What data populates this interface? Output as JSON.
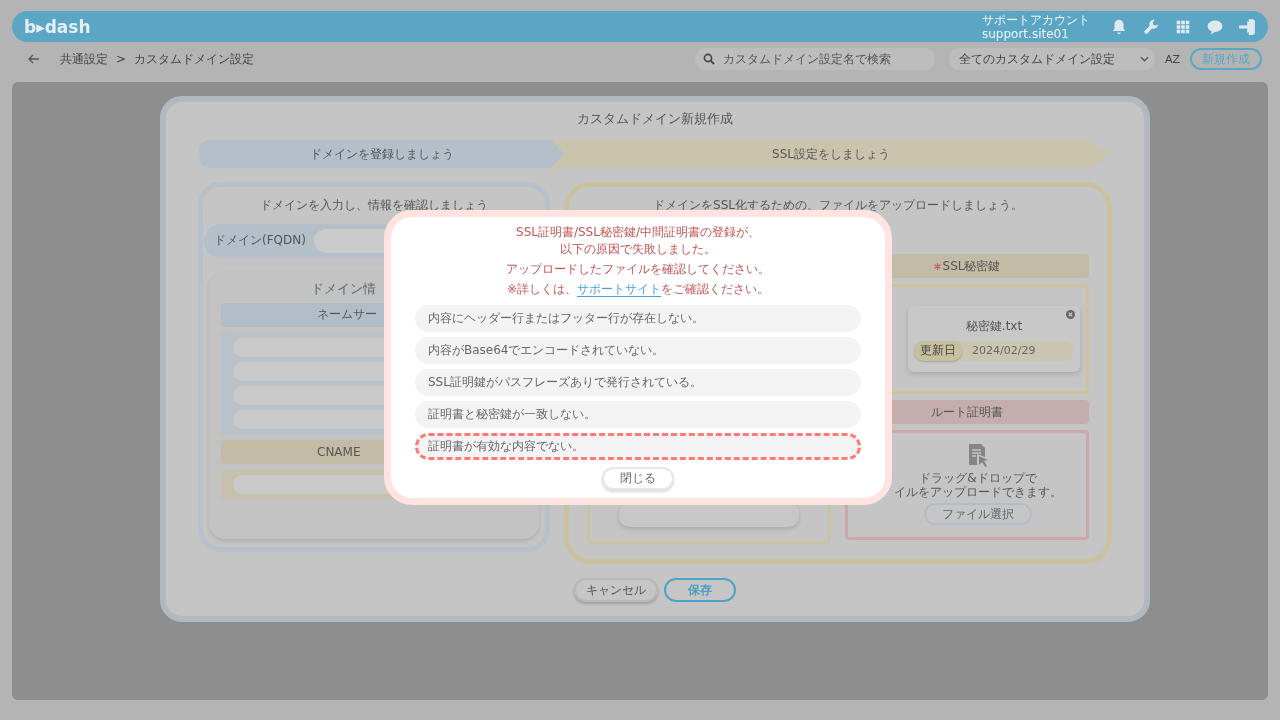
{
  "header": {
    "logo": "b▸dash",
    "account_name": "サポートアカウント",
    "account_id": "support.site01"
  },
  "toolbar": {
    "breadcrumb": [
      "共通設定",
      "カスタムドメイン設定"
    ],
    "breadcrumb_separator": ">",
    "search": {
      "placeholder": "カスタムドメイン設定名で検索"
    },
    "filter": {
      "value": "全てのカスタムドメイン設定"
    },
    "sort_label": "AZ",
    "new_button": "新規作成"
  },
  "modal": {
    "title": "カスタムドメイン新規作成",
    "steps": [
      {
        "label": "ドメインを登録しましょう",
        "selected": true
      },
      {
        "label": "SSL設定をしましょう",
        "selected": false
      }
    ],
    "domain_panel": {
      "instruction": "ドメインを入力し、情報を確認しましょう",
      "fqdn_label": "ドメイン(FQDN)",
      "info_title": "ドメイン情",
      "nameserver_header": "ネームサー",
      "cname_header": "CNAME"
    },
    "ssl_panel": {
      "instruction": "ドメインをSSL化するための、ファイルをアップロードしましょう。",
      "private_key": {
        "label": "SSL秘密鍵",
        "required": true,
        "file_name": "秘密鍵.txt",
        "date_label": "更新日",
        "date": "2024/02/29"
      },
      "root_cert": {
        "label": "ルート証明書",
        "drop_text_1": "ドラッグ&ドロップで",
        "drop_text_2": "イルをアップロードできます。",
        "file_button": "ファイル選択"
      }
    },
    "buttons": [
      "キャンセル",
      "保存"
    ]
  },
  "error_dialog": {
    "title_lines": [
      "SSL証明書/SSL秘密鍵/中間証明書の登録が、",
      "以下の原因で失敗しました。"
    ],
    "message": "アップロードしたファイルを確認してください。",
    "note_before": "※詳しくは、",
    "link": "サポートサイト",
    "note_after": "をご確認ください。",
    "reasons": [
      {
        "text": "内容にヘッダー行またはフッター行が存在しない。",
        "highlighted": false
      },
      {
        "text": "内容がBase64でエンコードされていない。",
        "highlighted": false
      },
      {
        "text": "SSL証明鍵がパスフレーズありで発行されている。",
        "highlighted": false
      },
      {
        "text": "証明書と秘密鍵が一致しない。",
        "highlighted": false
      },
      {
        "text": "証明書が有効な内容でない。",
        "highlighted": true
      }
    ],
    "close_button": "閉じる"
  }
}
